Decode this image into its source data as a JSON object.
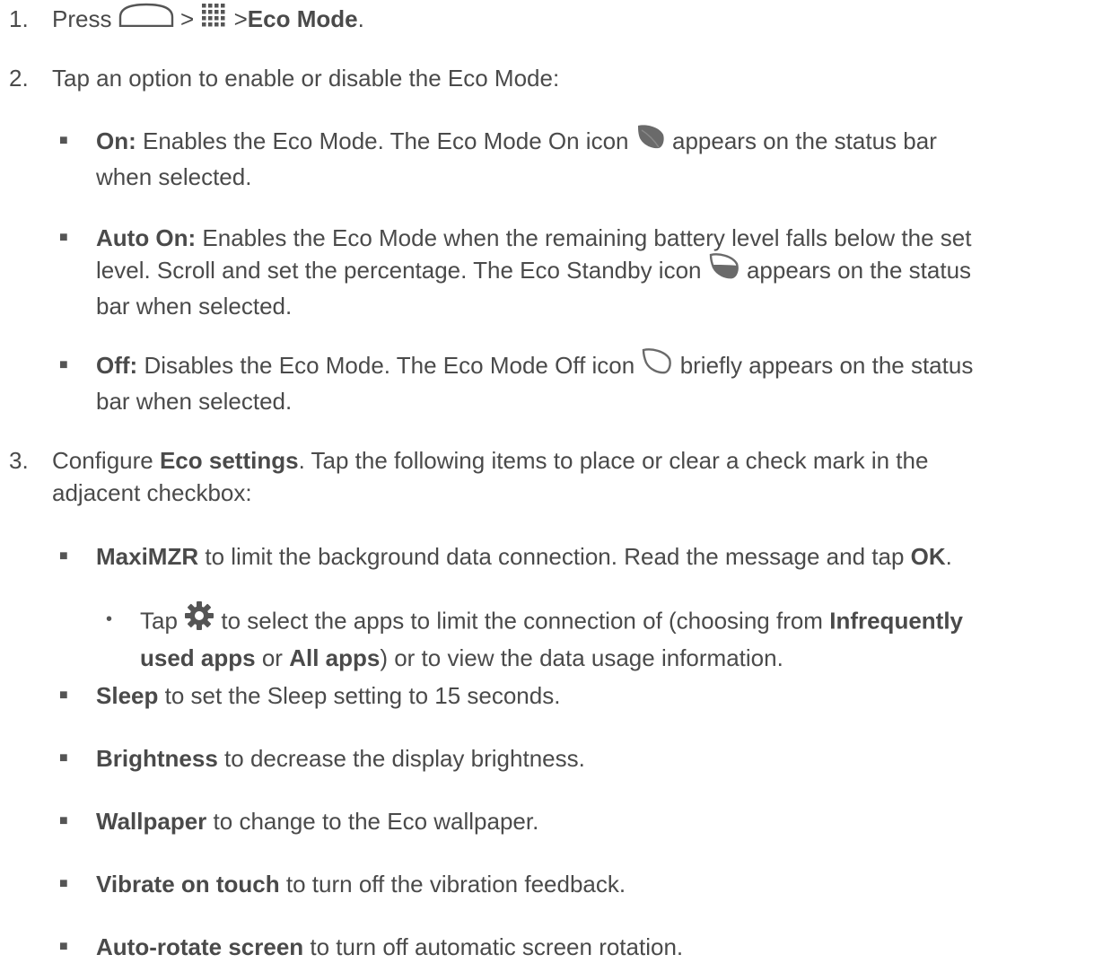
{
  "step1": {
    "num": "1.",
    "press": "Press",
    "sep1": ">",
    "sep2": ">",
    "target": "Eco Mode",
    "end": ".",
    "icons": [
      "home-key-icon",
      "apps-grid-icon"
    ]
  },
  "step2": {
    "num": "2.",
    "text": "Tap an option to enable or disable the Eco Mode:",
    "on": {
      "label": "On:",
      "text1": "Enables the Eco Mode. The Eco Mode On icon",
      "text2": "appears on the status bar",
      "text3": "when selected.",
      "icon": "leaf-filled-icon"
    },
    "auto": {
      "label": "Auto On:",
      "text1": "Enables the Eco Mode when the remaining battery level falls below the set",
      "text2": "level. Scroll and set the percentage. The Eco Standby icon",
      "text3": "appears on the status",
      "text4": "bar when selected.",
      "icon": "leaf-half-icon"
    },
    "off": {
      "label": "Off:",
      "text1": "Disables the Eco Mode. The Eco Mode Off icon",
      "text2": "briefly appears on the status",
      "text3": "bar when selected.",
      "icon": "leaf-outline-icon"
    }
  },
  "step3": {
    "num": "3.",
    "configure": "Configure",
    "eco_settings": "Eco settings",
    "text1": ". Tap the following items to place or clear a check mark in the",
    "text2": "adjacent checkbox:",
    "maximzr": {
      "label": "MaxiMZR",
      "text": "to limit the background data connection. Read the message and tap",
      "ok": "OK",
      "end": "."
    },
    "sub": {
      "tap": "Tap",
      "text1": "to select the apps to limit the connection of (choosing from",
      "infrequent1": "Infrequently",
      "infrequent2": "used apps",
      "or": "or",
      "all_apps": "All apps",
      "text2": ") or to view the data usage information.",
      "icon": "gear-icon"
    },
    "items": [
      {
        "label": "Sleep",
        "text": "to set the Sleep setting to 15 seconds."
      },
      {
        "label": "Brightness",
        "text": "to decrease the display brightness."
      },
      {
        "label": "Wallpaper",
        "text": "to change to the Eco wallpaper."
      },
      {
        "label": "Vibrate on touch",
        "text": "to turn off the vibration feedback."
      },
      {
        "label": "Auto-rotate screen",
        "text": "to turn off automatic screen rotation."
      }
    ]
  },
  "colors": {
    "text": "#4a4a4a",
    "icon": "#555555",
    "leaf": "#6a6a6a"
  }
}
